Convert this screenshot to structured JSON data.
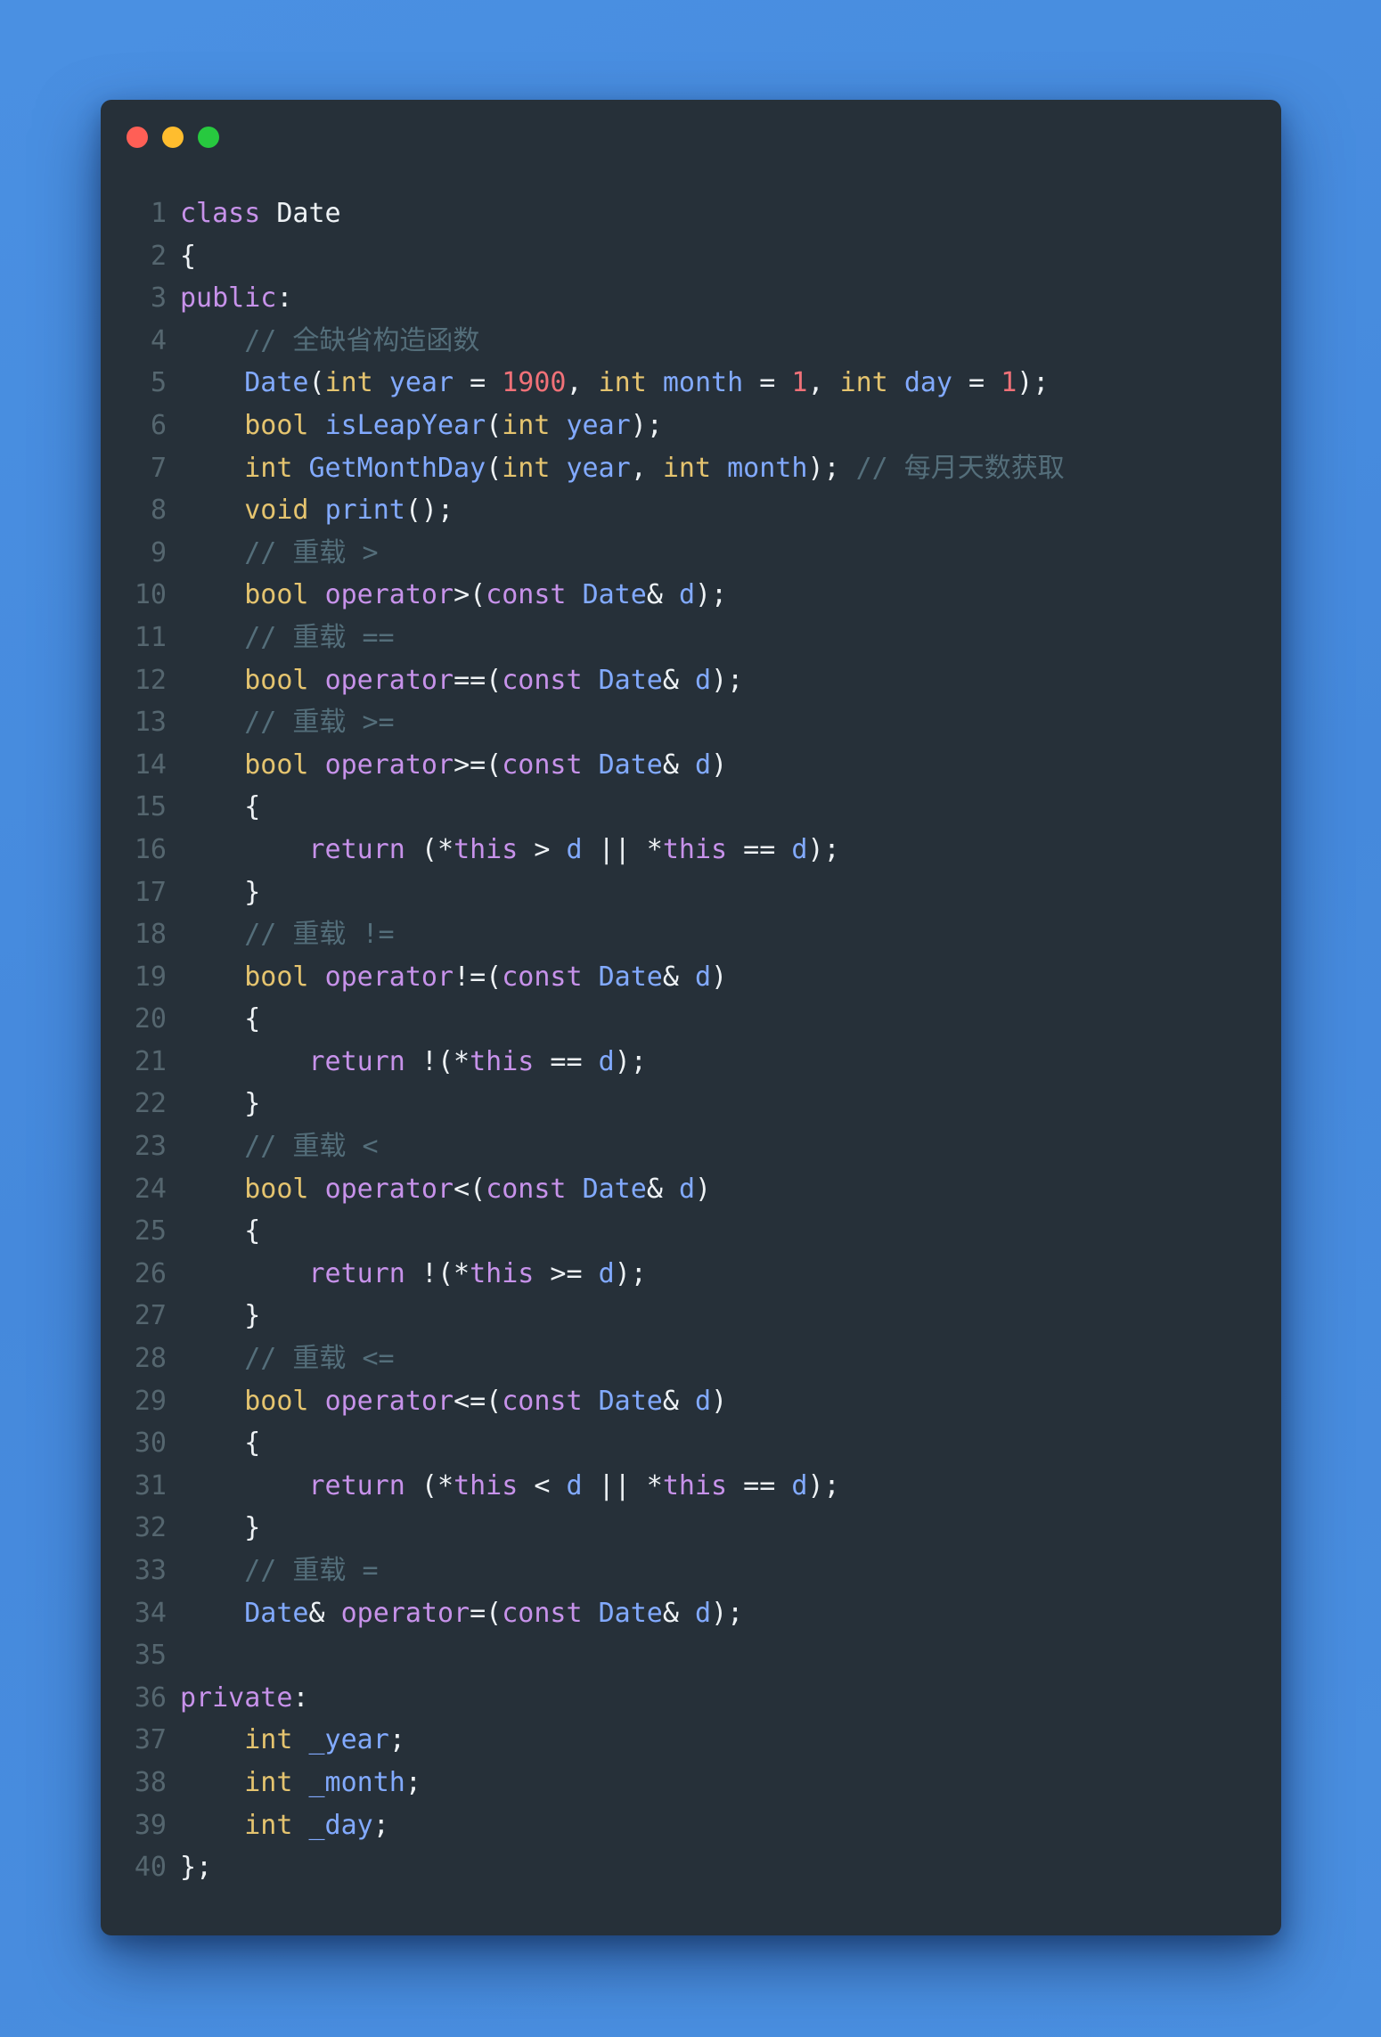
{
  "window": {
    "controls": [
      {
        "name": "close",
        "color": "#ff5f56"
      },
      {
        "name": "minimize",
        "color": "#ffbd2e"
      },
      {
        "name": "maximize",
        "color": "#27c93f"
      }
    ]
  },
  "code": {
    "language": "cpp",
    "lines": [
      [
        [
          "kw",
          "class"
        ],
        [
          "p",
          " Date"
        ]
      ],
      [
        [
          "p",
          "{"
        ]
      ],
      [
        [
          "kw",
          "public"
        ],
        [
          "p",
          ":"
        ]
      ],
      [
        [
          "p",
          "    "
        ],
        [
          "cm",
          "// 全缺省构造函数"
        ]
      ],
      [
        [
          "p",
          "    "
        ],
        [
          "fn",
          "Date"
        ],
        [
          "p",
          "("
        ],
        [
          "type",
          "int"
        ],
        [
          "p",
          " "
        ],
        [
          "var",
          "year"
        ],
        [
          "p",
          " = "
        ],
        [
          "num",
          "1900"
        ],
        [
          "p",
          ", "
        ],
        [
          "type",
          "int"
        ],
        [
          "p",
          " "
        ],
        [
          "var",
          "month"
        ],
        [
          "p",
          " = "
        ],
        [
          "num",
          "1"
        ],
        [
          "p",
          ", "
        ],
        [
          "type",
          "int"
        ],
        [
          "p",
          " "
        ],
        [
          "var",
          "day"
        ],
        [
          "p",
          " = "
        ],
        [
          "num",
          "1"
        ],
        [
          "p",
          ");"
        ]
      ],
      [
        [
          "p",
          "    "
        ],
        [
          "type",
          "bool"
        ],
        [
          "p",
          " "
        ],
        [
          "fn",
          "isLeapYear"
        ],
        [
          "p",
          "("
        ],
        [
          "type",
          "int"
        ],
        [
          "p",
          " "
        ],
        [
          "var",
          "year"
        ],
        [
          "p",
          ");"
        ]
      ],
      [
        [
          "p",
          "    "
        ],
        [
          "type",
          "int"
        ],
        [
          "p",
          " "
        ],
        [
          "fn",
          "GetMonthDay"
        ],
        [
          "p",
          "("
        ],
        [
          "type",
          "int"
        ],
        [
          "p",
          " "
        ],
        [
          "var",
          "year"
        ],
        [
          "p",
          ", "
        ],
        [
          "type",
          "int"
        ],
        [
          "p",
          " "
        ],
        [
          "var",
          "month"
        ],
        [
          "p",
          "); "
        ],
        [
          "cm",
          "// 每月天数获取"
        ]
      ],
      [
        [
          "p",
          "    "
        ],
        [
          "type",
          "void"
        ],
        [
          "p",
          " "
        ],
        [
          "fn",
          "print"
        ],
        [
          "p",
          "();"
        ]
      ],
      [
        [
          "p",
          "    "
        ],
        [
          "cm",
          "// 重载 >"
        ]
      ],
      [
        [
          "p",
          "    "
        ],
        [
          "type",
          "bool"
        ],
        [
          "p",
          " "
        ],
        [
          "kw",
          "operator"
        ],
        [
          "p",
          ">("
        ],
        [
          "kw",
          "const"
        ],
        [
          "p",
          " "
        ],
        [
          "fn",
          "Date"
        ],
        [
          "p",
          "& "
        ],
        [
          "var",
          "d"
        ],
        [
          "p",
          ");"
        ]
      ],
      [
        [
          "p",
          "    "
        ],
        [
          "cm",
          "// 重载 =="
        ]
      ],
      [
        [
          "p",
          "    "
        ],
        [
          "type",
          "bool"
        ],
        [
          "p",
          " "
        ],
        [
          "kw",
          "operator"
        ],
        [
          "p",
          "==("
        ],
        [
          "kw",
          "const"
        ],
        [
          "p",
          " "
        ],
        [
          "fn",
          "Date"
        ],
        [
          "p",
          "& "
        ],
        [
          "var",
          "d"
        ],
        [
          "p",
          ");"
        ]
      ],
      [
        [
          "p",
          "    "
        ],
        [
          "cm",
          "// 重载 >="
        ]
      ],
      [
        [
          "p",
          "    "
        ],
        [
          "type",
          "bool"
        ],
        [
          "p",
          " "
        ],
        [
          "kw",
          "operator"
        ],
        [
          "p",
          ">=("
        ],
        [
          "kw",
          "const"
        ],
        [
          "p",
          " "
        ],
        [
          "fn",
          "Date"
        ],
        [
          "p",
          "& "
        ],
        [
          "var",
          "d"
        ],
        [
          "p",
          ")"
        ]
      ],
      [
        [
          "p",
          "    {"
        ]
      ],
      [
        [
          "p",
          "        "
        ],
        [
          "kw",
          "return"
        ],
        [
          "p",
          " (*"
        ],
        [
          "kw",
          "this"
        ],
        [
          "p",
          " > "
        ],
        [
          "var",
          "d"
        ],
        [
          "p",
          " || *"
        ],
        [
          "kw",
          "this"
        ],
        [
          "p",
          " == "
        ],
        [
          "var",
          "d"
        ],
        [
          "p",
          ");"
        ]
      ],
      [
        [
          "p",
          "    }"
        ]
      ],
      [
        [
          "p",
          "    "
        ],
        [
          "cm",
          "// 重载 !="
        ]
      ],
      [
        [
          "p",
          "    "
        ],
        [
          "type",
          "bool"
        ],
        [
          "p",
          " "
        ],
        [
          "kw",
          "operator"
        ],
        [
          "p",
          "!=("
        ],
        [
          "kw",
          "const"
        ],
        [
          "p",
          " "
        ],
        [
          "fn",
          "Date"
        ],
        [
          "p",
          "& "
        ],
        [
          "var",
          "d"
        ],
        [
          "p",
          ")"
        ]
      ],
      [
        [
          "p",
          "    {"
        ]
      ],
      [
        [
          "p",
          "        "
        ],
        [
          "kw",
          "return"
        ],
        [
          "p",
          " !(*"
        ],
        [
          "kw",
          "this"
        ],
        [
          "p",
          " == "
        ],
        [
          "var",
          "d"
        ],
        [
          "p",
          ");"
        ]
      ],
      [
        [
          "p",
          "    }"
        ]
      ],
      [
        [
          "p",
          "    "
        ],
        [
          "cm",
          "// 重载 <"
        ]
      ],
      [
        [
          "p",
          "    "
        ],
        [
          "type",
          "bool"
        ],
        [
          "p",
          " "
        ],
        [
          "kw",
          "operator"
        ],
        [
          "p",
          "<("
        ],
        [
          "kw",
          "const"
        ],
        [
          "p",
          " "
        ],
        [
          "fn",
          "Date"
        ],
        [
          "p",
          "& "
        ],
        [
          "var",
          "d"
        ],
        [
          "p",
          ")"
        ]
      ],
      [
        [
          "p",
          "    {"
        ]
      ],
      [
        [
          "p",
          "        "
        ],
        [
          "kw",
          "return"
        ],
        [
          "p",
          " !(*"
        ],
        [
          "kw",
          "this"
        ],
        [
          "p",
          " >= "
        ],
        [
          "var",
          "d"
        ],
        [
          "p",
          ");"
        ]
      ],
      [
        [
          "p",
          "    }"
        ]
      ],
      [
        [
          "p",
          "    "
        ],
        [
          "cm",
          "// 重载 <="
        ]
      ],
      [
        [
          "p",
          "    "
        ],
        [
          "type",
          "bool"
        ],
        [
          "p",
          " "
        ],
        [
          "kw",
          "operator"
        ],
        [
          "p",
          "<=("
        ],
        [
          "kw",
          "const"
        ],
        [
          "p",
          " "
        ],
        [
          "fn",
          "Date"
        ],
        [
          "p",
          "& "
        ],
        [
          "var",
          "d"
        ],
        [
          "p",
          ")"
        ]
      ],
      [
        [
          "p",
          "    {"
        ]
      ],
      [
        [
          "p",
          "        "
        ],
        [
          "kw",
          "return"
        ],
        [
          "p",
          " (*"
        ],
        [
          "kw",
          "this"
        ],
        [
          "p",
          " < "
        ],
        [
          "var",
          "d"
        ],
        [
          "p",
          " || *"
        ],
        [
          "kw",
          "this"
        ],
        [
          "p",
          " == "
        ],
        [
          "var",
          "d"
        ],
        [
          "p",
          ");"
        ]
      ],
      [
        [
          "p",
          "    }"
        ]
      ],
      [
        [
          "p",
          "    "
        ],
        [
          "cm",
          "// 重载 ="
        ]
      ],
      [
        [
          "p",
          "    "
        ],
        [
          "fn",
          "Date"
        ],
        [
          "p",
          "& "
        ],
        [
          "kw",
          "operator"
        ],
        [
          "p",
          "=("
        ],
        [
          "kw",
          "const"
        ],
        [
          "p",
          " "
        ],
        [
          "fn",
          "Date"
        ],
        [
          "p",
          "& "
        ],
        [
          "var",
          "d"
        ],
        [
          "p",
          ");"
        ]
      ],
      [],
      [
        [
          "kw",
          "private"
        ],
        [
          "p",
          ":"
        ]
      ],
      [
        [
          "p",
          "    "
        ],
        [
          "type",
          "int"
        ],
        [
          "p",
          " "
        ],
        [
          "var",
          "_year"
        ],
        [
          "p",
          ";"
        ]
      ],
      [
        [
          "p",
          "    "
        ],
        [
          "type",
          "int"
        ],
        [
          "p",
          " "
        ],
        [
          "var",
          "_month"
        ],
        [
          "p",
          ";"
        ]
      ],
      [
        [
          "p",
          "    "
        ],
        [
          "type",
          "int"
        ],
        [
          "p",
          " "
        ],
        [
          "var",
          "_day"
        ],
        [
          "p",
          ";"
        ]
      ],
      [
        [
          "p",
          "};"
        ]
      ]
    ]
  }
}
